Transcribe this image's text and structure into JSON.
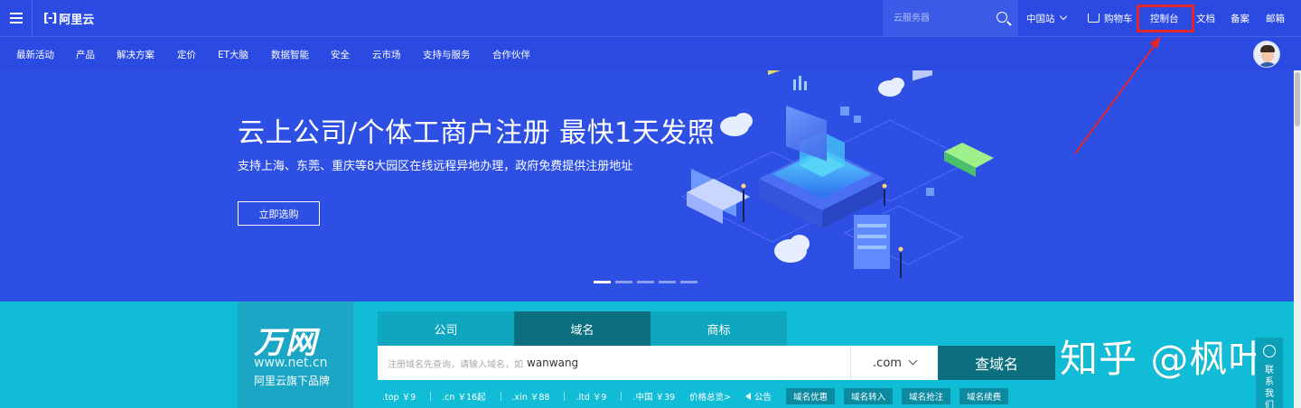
{
  "topbar": {
    "logo_text": "阿里云",
    "logo_mark": "[-]",
    "search_placeholder": "云服务器",
    "region": "中国站",
    "cart": "购物车",
    "console": "控制台",
    "docs": "文档",
    "record": "备案",
    "mail": "邮箱"
  },
  "nav": {
    "items": [
      "最新活动",
      "产品",
      "解决方案",
      "定价",
      "ET大脑",
      "数据智能",
      "安全",
      "云市场",
      "支持与服务",
      "合作伙伴"
    ]
  },
  "hero": {
    "title": "云上公司/个体工商户注册 最快1天发照",
    "subtitle": "支持上海、东莞、重庆等8大园区在线远程异地办理，政府免费提供注册地址",
    "button": "立即选购",
    "slides": 5,
    "active_slide": 1
  },
  "domain": {
    "brand_logo": "万网",
    "brand_url": "www.net.cn",
    "brand_sub": "阿里云旗下品牌",
    "tabs": [
      "公司",
      "域名",
      "商标"
    ],
    "active_tab": "域名",
    "search_placeholder": "注册域名先查询，请输入域名，如",
    "search_value": "wanwang",
    "suffix": ".com",
    "search_button": "查域名",
    "prices": [
      ".top ￥9",
      ".cn ￥16起",
      ".xin ￥88",
      ".ltd ￥9",
      ".中国 ￥39"
    ],
    "price_more": "价格总览>",
    "notice": "公告",
    "tags": [
      "域名优惠",
      "域名转入",
      "域名抢注",
      "域名续费"
    ]
  },
  "watermark": "知乎 @枫叶",
  "contact": "联系我们",
  "colors": {
    "brand_blue": "#2b4ae2",
    "domain_teal": "#10bcd6",
    "dark_teal": "#0b6f7f",
    "highlight_red": "#e3262e"
  }
}
